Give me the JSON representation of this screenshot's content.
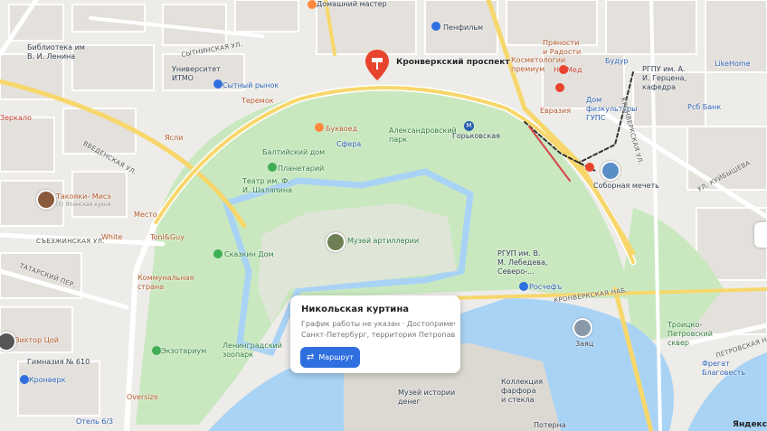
{
  "map": {
    "selected_place": {
      "title": "Никольская куртина",
      "hours": "График работы не указан · Достопримеча...",
      "address": "Санкт-Петербург, территория Петропавло...",
      "route_button": "Маршрут"
    },
    "pin_label": "Кронверкский проспект",
    "labels": {
      "domashniy_master": "Домашний мастер",
      "penfilm": "Пенфильм",
      "pryanosti": "Пряности\nи Радости",
      "kosmetolog": "Косметологии\nпремиум",
      "budur": "Будур",
      "ns_med": "НС Мед",
      "rgpu": "РГПУ им. А.\nИ. Герцена,\nкафедра",
      "likehome": "LikeHome",
      "biblioteka": "Библиотека им\nВ. И. Ленина",
      "itmo": "Университет\nИТМО",
      "sytny": "Сытный рынок",
      "teremok": "Теремок",
      "kronverksky": "Кронверкский проспект",
      "bukvoed": "Буквоед",
      "aleksandrovsky": "Александровский\nпарк",
      "gorkovskaya": "Горьковская",
      "evrazia": "Евразия",
      "dom_fizkultury": "Дом физкультуры\nГУПС",
      "rsb": "Рсб Банк",
      "zerkalo": "Зеркало",
      "yasli": "Ясли",
      "baltiysky": "Балтийский дом",
      "sfera": "Сфера",
      "planetary": "Планетарий",
      "teatr": "Театр им. Ф.\nИ. Шаляпина",
      "sobornaya": "Соборная мечеть",
      "takoyaki": "Такояки- Мисэ",
      "takoyaki_sub": "(5) Японская кухня",
      "mesto": "Место",
      "white": "White",
      "toni": "Toni&Guy",
      "skazkin": "Сказкин Дом",
      "muzey_art": "Музей артиллерии",
      "rgup": "РГУП им. В.\nМ. Лебедева,\nСеверо-...",
      "kommunalnaya": "Коммунальная\nстрана",
      "roschefs": "Росчефъ",
      "kronverkskaya_nab": "КРОНВЕРКСКАЯ НАБ.",
      "ekzotarium": "Экзотариум",
      "leningradsky_zoo": "Ленинградский\nзоопарк",
      "viktor_tsoy": "Виктор Цой",
      "gimnaziya": "Гимназия № 610",
      "kronverk": "Кронверк",
      "zayats": "Заяц",
      "troitsko": "Троицко-\nПетровский\nсквер",
      "oversize": "Oversize",
      "kollektsiya": "Коллекция\nфарфора\nи стекла",
      "muzey_deneg": "Музей истории\nденег",
      "fregat": "Фрегат\nБлаговесть",
      "otel": "Отель 6/3",
      "poterna": "Потерна",
      "vvedenskaya": "ВВЕДЕНСКАЯ УЛ.",
      "sytninskaya": "СЫТНИНСКАЯ УЛ.",
      "syezhinskaya": "СЪЕЗЖИНСКАЯ УЛ.",
      "tatarsky": "ТАТАРСКИЙ ПЕР.",
      "kuybysheva": "УЛ. КУЙБЫШЕВА",
      "petrovskaya": "ПЕТРОВСКАЯ НАБ.",
      "kronverkskaya_ul": "КРОНВЕРКСКАЯ УЛ."
    },
    "logo": "Яндекс",
    "colors": {
      "park": "#c9e8c0",
      "water": "#a9d3f5",
      "road_yellow": "#f7d76b",
      "accent_blue": "#2f6fe0",
      "pin_red": "#e8442d"
    }
  }
}
